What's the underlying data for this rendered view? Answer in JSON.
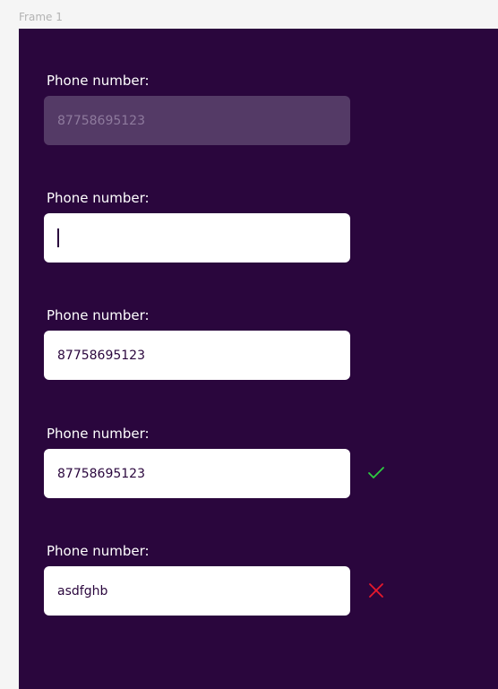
{
  "frame": {
    "title": "Frame 1"
  },
  "fields": [
    {
      "label": "Phone number:",
      "value": "",
      "placeholder": "87758695123",
      "state": "disabled"
    },
    {
      "label": "Phone number:",
      "value": "",
      "placeholder": "",
      "state": "focused"
    },
    {
      "label": "Phone number:",
      "value": "87758695123",
      "placeholder": "",
      "state": "filled"
    },
    {
      "label": "Phone number:",
      "value": "87758695123",
      "placeholder": "",
      "state": "valid"
    },
    {
      "label": "Phone number:",
      "value": "asdfghb",
      "placeholder": "",
      "state": "invalid"
    }
  ],
  "icons": {
    "valid": "check-icon",
    "invalid": "cross-icon"
  },
  "colors": {
    "frame_background": "#2a063d",
    "input_background": "#ffffff",
    "disabled_input_background": "#543a66",
    "disabled_text": "#8e7a9d",
    "label_text": "#ffffff",
    "input_text": "#2a063d",
    "valid": "#2ecc40",
    "invalid": "#e8192c"
  }
}
